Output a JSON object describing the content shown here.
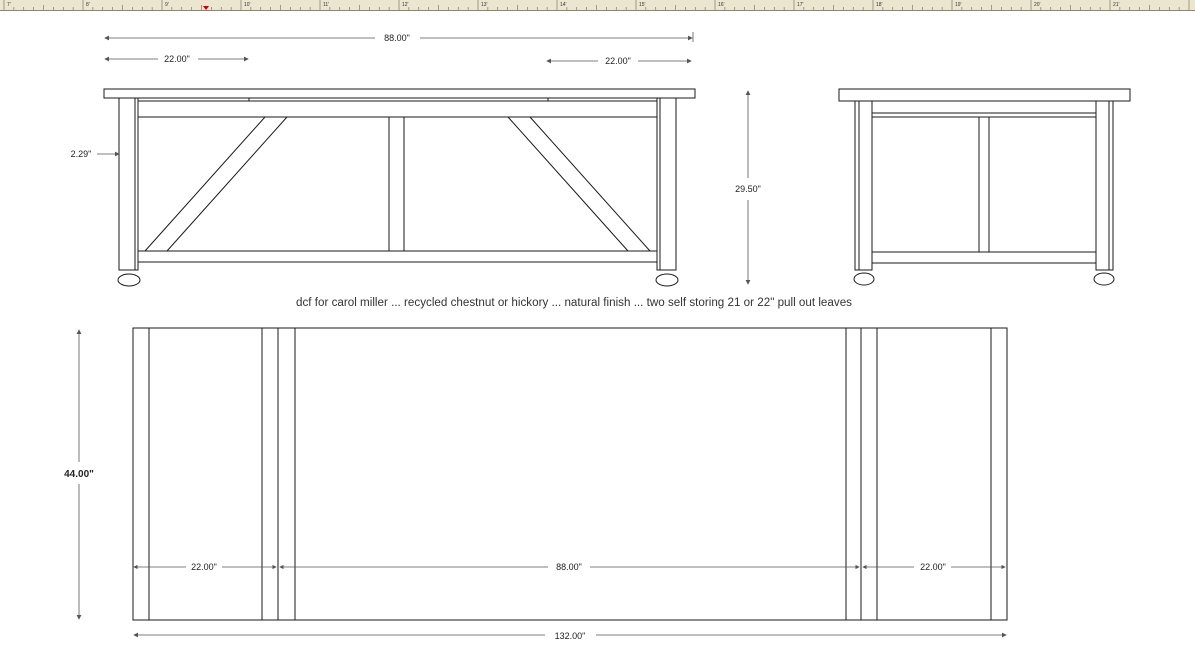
{
  "ruler": {
    "labels": [
      "7'",
      "8'",
      "9'",
      "10'",
      "11'",
      "12'",
      "13'",
      "14'",
      "15'",
      "16'",
      "17'",
      "18'",
      "19'",
      "20'",
      "21'"
    ]
  },
  "front_view": {
    "overall_width": "88.00\"",
    "left_leaf": "22.00\"",
    "right_leaf": "22.00\"",
    "apron_height": "2.29\""
  },
  "side_view": {
    "height": "29.50\""
  },
  "caption": "dcf for carol miller ... recycled chestnut or hickory ... natural finish ... two self storing 21 or 22\" pull out leaves",
  "top_view": {
    "depth": "44.00\"",
    "left_leaf": "22.00\"",
    "center": "88.00\"",
    "right_leaf": "22.00\"",
    "overall_length": "132.00\""
  },
  "colors": {
    "ruler_bg": "#ebe6d0",
    "line": "#1a1a1a",
    "dim_line": "#555555",
    "marker": "#cc0000"
  }
}
